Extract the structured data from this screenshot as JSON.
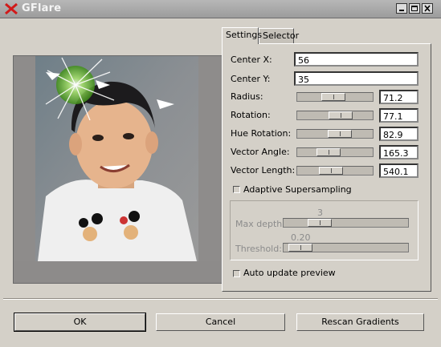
{
  "window": {
    "title": "GFlare"
  },
  "tabs": [
    {
      "label": "Settings"
    },
    {
      "label": "Selector"
    }
  ],
  "settings": {
    "center_x": {
      "label": "Center X:",
      "value": "56"
    },
    "center_y": {
      "label": "Center Y:",
      "value": "35"
    },
    "sliders": [
      {
        "label": "Radius:",
        "value": "71.2",
        "fraction": 0.47
      },
      {
        "label": "Rotation:",
        "value": "77.1",
        "fraction": 0.61
      },
      {
        "label": "Hue Rotation:",
        "value": "82.9",
        "fraction": 0.6
      },
      {
        "label": "Vector Angle:",
        "value": "165.3",
        "fraction": 0.38
      },
      {
        "label": "Vector Length:",
        "value": "540.1",
        "fraction": 0.42
      }
    ],
    "adaptive_label": "Adaptive Supersampling",
    "max_depth": {
      "label": "Max depth:",
      "value": "3"
    },
    "threshold": {
      "label": "Threshold:",
      "value": "0.20"
    },
    "auto_update_label": "Auto update preview"
  },
  "buttons": {
    "ok": "OK",
    "cancel": "Cancel",
    "rescan": "Rescan Gradients"
  },
  "icons": {
    "app": "x-icon",
    "minimize": "minimize-icon",
    "maximize": "maximize-icon",
    "close": "close-icon"
  },
  "colors": {
    "title_bar": "#a9a9a9",
    "window_bg": "#d4d0c8",
    "app_icon": "#d11a1a"
  }
}
